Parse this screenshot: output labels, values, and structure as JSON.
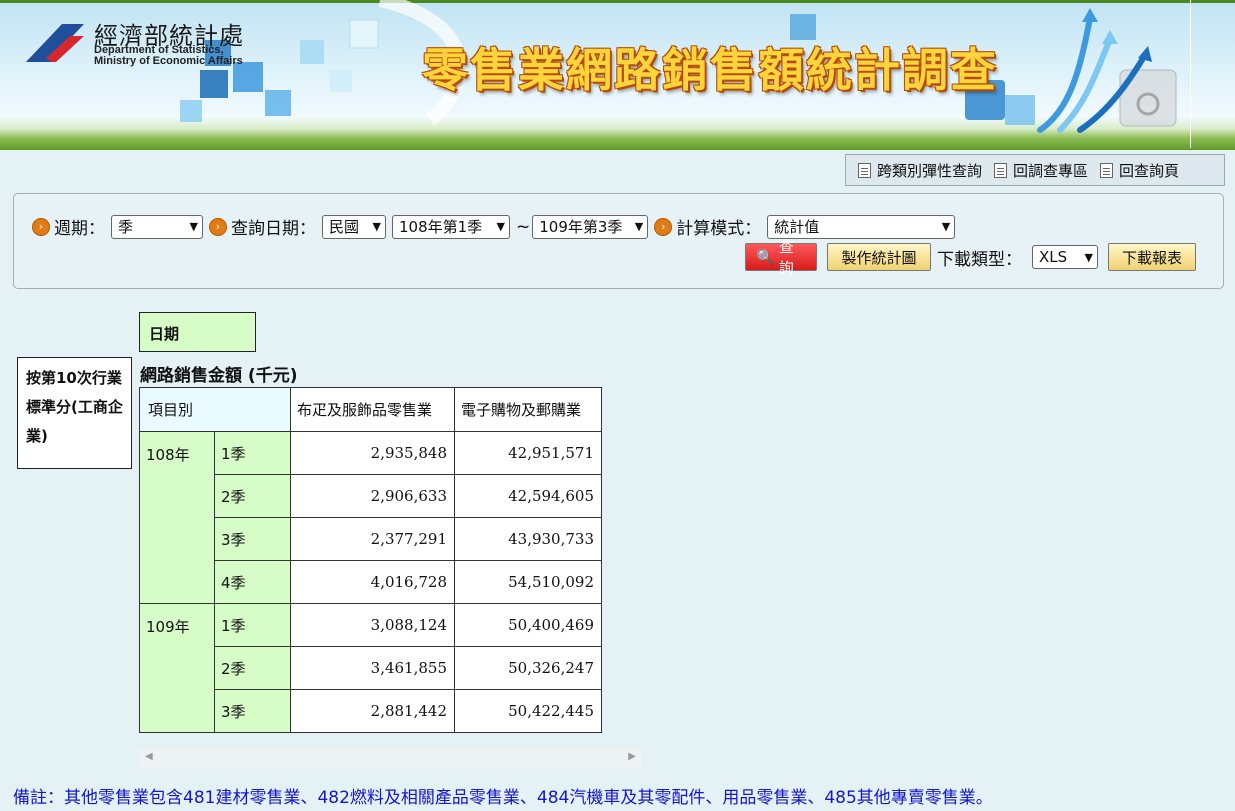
{
  "header": {
    "logo_cn": "經濟部統計處",
    "logo_en_line1": "Department of Statistics,",
    "logo_en_line2": "Ministry of Economic Affairs",
    "title": "零售業網路銷售額統計調查",
    "brand_colors": {
      "green": "#5f9a2a",
      "title_yellow": "#ffd43c",
      "logo_blue": "#1f4e9a",
      "logo_red": "#d8262f"
    }
  },
  "toplinks": [
    {
      "label": "跨類別彈性查詢"
    },
    {
      "label": "回調查專區"
    },
    {
      "label": "回查詢頁"
    }
  ],
  "query": {
    "period_label": "週期：",
    "period_value": "季",
    "date_label": "查詢日期：",
    "calendar_value": "民國",
    "start_value": "108年第1季",
    "range_sep": "~",
    "end_value": "109年第3季",
    "mode_label": "計算模式：",
    "mode_value": "統計值",
    "query_button": "查詢",
    "chart_button": "製作統計圖",
    "download_type_label": "下載類型：",
    "download_type_value": "XLS",
    "download_button": "下載報表"
  },
  "table": {
    "date_header": "日期",
    "side_header": "按第10次行業標準分(工商企業)",
    "title": "網路銷售金額 (千元)",
    "item_header": "項目別",
    "columns": [
      "布疋及服飾品零售業",
      "電子購物及郵購業"
    ],
    "groups": [
      {
        "year": "108年",
        "rows": [
          {
            "q": "1季",
            "v1": "2,935,848",
            "v2": "42,951,571"
          },
          {
            "q": "2季",
            "v1": "2,906,633",
            "v2": "42,594,605"
          },
          {
            "q": "3季",
            "v1": "2,377,291",
            "v2": "43,930,733"
          },
          {
            "q": "4季",
            "v1": "4,016,728",
            "v2": "54,510,092"
          }
        ]
      },
      {
        "year": "109年",
        "rows": [
          {
            "q": "1季",
            "v1": "3,088,124",
            "v2": "50,400,469"
          },
          {
            "q": "2季",
            "v1": "3,461,855",
            "v2": "50,326,247"
          },
          {
            "q": "3季",
            "v1": "2,881,442",
            "v2": "50,422,445"
          }
        ]
      }
    ]
  },
  "note": "備註：其他零售業包含481建材零售業、482燃料及相關產品零售業、484汽機車及其零配件、用品零售業、485其他專賣零售業。"
}
